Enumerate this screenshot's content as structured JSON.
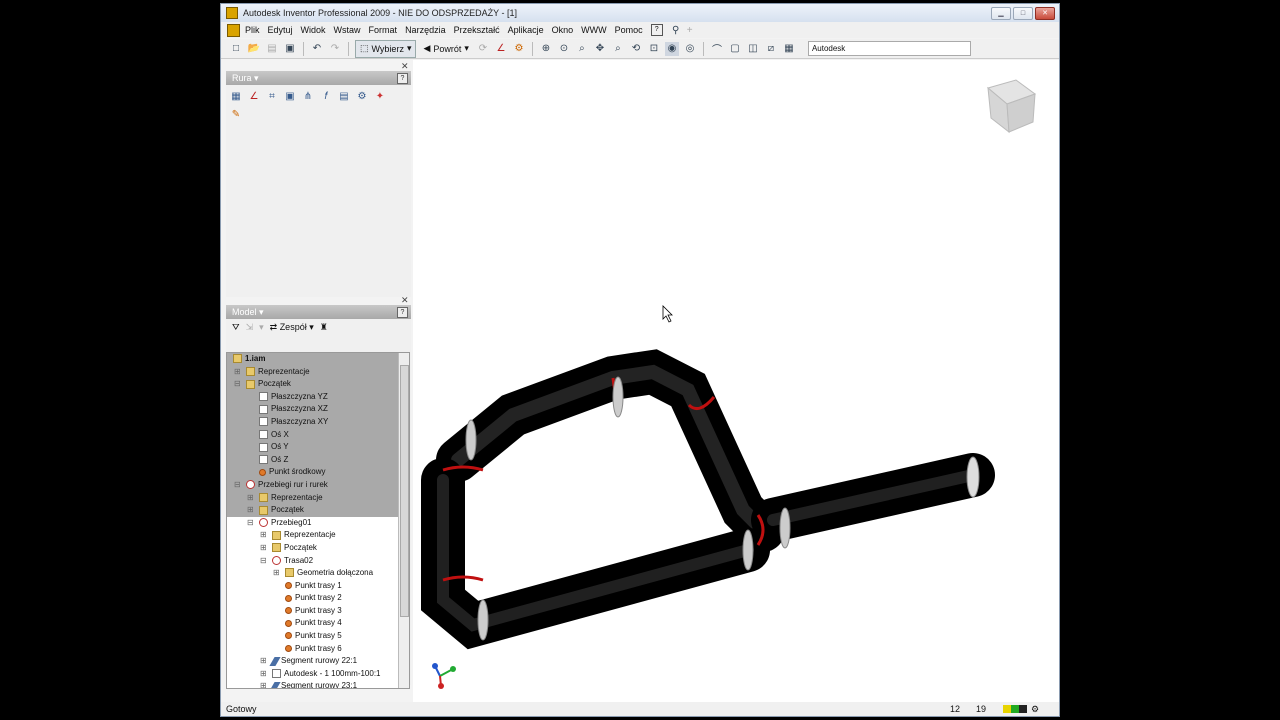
{
  "window": {
    "title": "Autodesk Inventor Professional 2009 - NIE DO ODSPRZEDAŻY - [1]"
  },
  "menu": [
    "Plik",
    "Edytuj",
    "Widok",
    "Wstaw",
    "Format",
    "Narzędzia",
    "Przekształć",
    "Aplikacje",
    "Okno",
    "WWW",
    "Pomoc"
  ],
  "toolbar": {
    "select_label": "Wybierz",
    "back_label": "Powrót",
    "search_value": "Autodesk"
  },
  "panel_rura": {
    "title": "Rura"
  },
  "panel_model": {
    "title": "Model",
    "filter_label": "Zespół"
  },
  "tree": [
    {
      "label": "1.iam",
      "indent": 0,
      "icon": "folder",
      "hl": true,
      "exp": ""
    },
    {
      "label": "Reprezentacje",
      "indent": 1,
      "icon": "folder",
      "hl": true,
      "exp": "+"
    },
    {
      "label": "Początek",
      "indent": 1,
      "icon": "folder",
      "hl": true,
      "exp": "-"
    },
    {
      "label": "Płaszczyzna YZ",
      "indent": 2,
      "icon": "plane",
      "hl": true,
      "exp": ""
    },
    {
      "label": "Płaszczyzna XZ",
      "indent": 2,
      "icon": "plane",
      "hl": true,
      "exp": ""
    },
    {
      "label": "Płaszczyzna XY",
      "indent": 2,
      "icon": "plane",
      "hl": true,
      "exp": ""
    },
    {
      "label": "Oś X",
      "indent": 2,
      "icon": "plane",
      "hl": true,
      "exp": ""
    },
    {
      "label": "Oś Y",
      "indent": 2,
      "icon": "plane",
      "hl": true,
      "exp": ""
    },
    {
      "label": "Oś Z",
      "indent": 2,
      "icon": "plane",
      "hl": true,
      "exp": ""
    },
    {
      "label": "Punkt środkowy",
      "indent": 2,
      "icon": "pt",
      "hl": true,
      "exp": ""
    },
    {
      "label": "Przebiegi rur i rurek",
      "indent": 1,
      "icon": "route",
      "hl": true,
      "exp": "-"
    },
    {
      "label": "Reprezentacje",
      "indent": 2,
      "icon": "folder",
      "hl": true,
      "exp": "+"
    },
    {
      "label": "Początek",
      "indent": 2,
      "icon": "folder",
      "hl": true,
      "exp": "+"
    },
    {
      "label": "Przebieg01",
      "indent": 2,
      "icon": "route",
      "hl": false,
      "exp": "-"
    },
    {
      "label": "Reprezentacje",
      "indent": 3,
      "icon": "folder",
      "hl": false,
      "exp": "+"
    },
    {
      "label": "Początek",
      "indent": 3,
      "icon": "folder",
      "hl": false,
      "exp": "+"
    },
    {
      "label": "Trasa02",
      "indent": 3,
      "icon": "route",
      "hl": false,
      "exp": "-"
    },
    {
      "label": "Geometria dołączona",
      "indent": 4,
      "icon": "folder",
      "hl": false,
      "exp": "+"
    },
    {
      "label": "Punkt trasy 1",
      "indent": 4,
      "icon": "pt",
      "hl": false,
      "exp": ""
    },
    {
      "label": "Punkt trasy 2",
      "indent": 4,
      "icon": "pt",
      "hl": false,
      "exp": ""
    },
    {
      "label": "Punkt trasy 3",
      "indent": 4,
      "icon": "pt",
      "hl": false,
      "exp": ""
    },
    {
      "label": "Punkt trasy 4",
      "indent": 4,
      "icon": "pt",
      "hl": false,
      "exp": ""
    },
    {
      "label": "Punkt trasy 5",
      "indent": 4,
      "icon": "pt",
      "hl": false,
      "exp": ""
    },
    {
      "label": "Punkt trasy 6",
      "indent": 4,
      "icon": "pt",
      "hl": false,
      "exp": ""
    },
    {
      "label": "Segment rurowy 22:1",
      "indent": 3,
      "icon": "seg",
      "hl": false,
      "exp": "+"
    },
    {
      "label": "Autodesk - 1 100mm-100:1",
      "indent": 3,
      "icon": "plane",
      "hl": false,
      "exp": "+"
    },
    {
      "label": "Segment rurowy 23:1",
      "indent": 3,
      "icon": "seg",
      "hl": false,
      "exp": "+"
    }
  ],
  "status": {
    "text": "Gotowy",
    "n1": "12",
    "n2": "19"
  }
}
